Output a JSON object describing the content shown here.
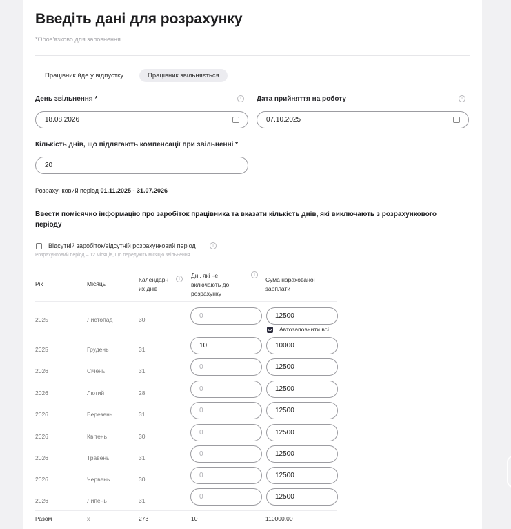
{
  "header": {
    "title": "Введіть дані для розрахунку",
    "required_note": "*Обов'язково для заповнення"
  },
  "tabs": [
    {
      "label": "Працівник йде у відпустку",
      "active": false
    },
    {
      "label": "Працівник звільняється",
      "active": true
    }
  ],
  "dismissal_date": {
    "label": "День звільнення *",
    "value": "18.08.2026"
  },
  "hire_date": {
    "label": "Дата прийняття на роботу",
    "value": "07.10.2025"
  },
  "compensation_days": {
    "label": "Кількість днів, що підлягають компенсації при звільненні *",
    "value": "20"
  },
  "period": {
    "prefix": "Розрахунковий період",
    "value": "01.11.2025 - 31.07.2026"
  },
  "section_title": "Ввести помісячно інформацію про заробіток працівника та вказати кількість днів, які виключають з розрахункового періоду",
  "no_income": {
    "label": "Відсутній заробіток/відсутній розрахунковий період",
    "checked": false
  },
  "hint": "Розрахунковий період – 12 місяців, що передують місяцю звільнення",
  "table": {
    "headers": {
      "year": "Рік",
      "month": "Місяць",
      "calendar_days": "Календарн\nих днів",
      "excluded_days": "Дні, які не\nвключають до\nрозрахунку",
      "salary": "Сума нарахованої\nзарплати"
    },
    "autofill": {
      "label": "Автозаповнити всі",
      "checked": true
    },
    "excluded_placeholder": "0",
    "rows": [
      {
        "year": "2025",
        "month": "Листопад",
        "days": "30",
        "excluded": "",
        "salary": "12500"
      },
      {
        "year": "2025",
        "month": "Грудень",
        "days": "31",
        "excluded": "10",
        "salary": "10000"
      },
      {
        "year": "2026",
        "month": "Січень",
        "days": "31",
        "excluded": "",
        "salary": "12500"
      },
      {
        "year": "2026",
        "month": "Лютий",
        "days": "28",
        "excluded": "",
        "salary": "12500"
      },
      {
        "year": "2026",
        "month": "Березень",
        "days": "31",
        "excluded": "",
        "salary": "12500"
      },
      {
        "year": "2026",
        "month": "Квітень",
        "days": "30",
        "excluded": "",
        "salary": "12500"
      },
      {
        "year": "2026",
        "month": "Травень",
        "days": "31",
        "excluded": "",
        "salary": "12500"
      },
      {
        "year": "2026",
        "month": "Червень",
        "days": "30",
        "excluded": "",
        "salary": "12500"
      },
      {
        "year": "2026",
        "month": "Липень",
        "days": "31",
        "excluded": "",
        "salary": "12500"
      }
    ],
    "total": {
      "label": "Разом",
      "month": "x",
      "days": "273",
      "excluded": "10",
      "salary": "110000.00"
    }
  }
}
